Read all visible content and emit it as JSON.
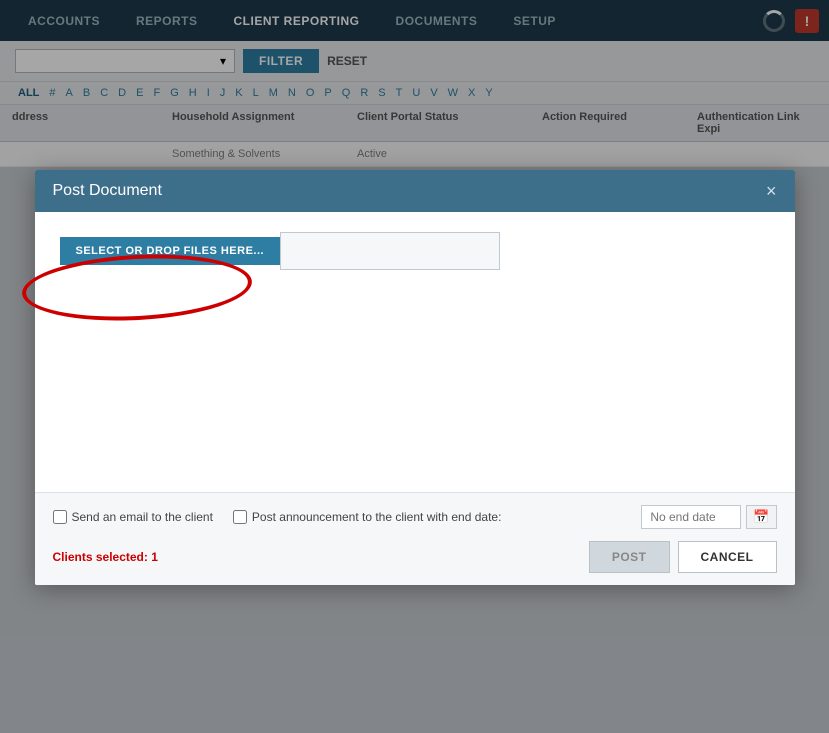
{
  "nav": {
    "items": [
      {
        "id": "accounts",
        "label": "ACCOUNTS",
        "active": false
      },
      {
        "id": "reports",
        "label": "REPORTS",
        "active": false
      },
      {
        "id": "client-reporting",
        "label": "CLIENT REPORTING",
        "active": true
      },
      {
        "id": "documents",
        "label": "DOCUMENTS",
        "active": false
      },
      {
        "id": "setup",
        "label": "SETUP",
        "active": false
      }
    ]
  },
  "filter": {
    "button_label": "FILTER",
    "reset_label": "RESET",
    "dropdown_placeholder": ""
  },
  "alpha_bar": {
    "items": [
      "ALL",
      "#",
      "A",
      "B",
      "C",
      "D",
      "E",
      "F",
      "G",
      "H",
      "I",
      "J",
      "K",
      "L",
      "M",
      "N",
      "O",
      "P",
      "Q",
      "R",
      "S",
      "T",
      "U",
      "V",
      "W",
      "X",
      "Y"
    ]
  },
  "table": {
    "columns": [
      "ddress",
      "Household Assignment",
      "Client Portal Status",
      "Action Required",
      "Authentication Link Expi"
    ],
    "partial_row": [
      "",
      "Something & Solvents",
      "Active",
      "",
      ""
    ]
  },
  "modal": {
    "title": "Post Document",
    "close_label": "×",
    "select_files_btn": "SELECT OR DROP FILES HERE...",
    "drop_placeholder": "",
    "send_email_label": "Send an email to the client",
    "post_announcement_label": "Post announcement to the client with end date:",
    "date_placeholder": "No end date",
    "clients_selected": "Clients selected: 1",
    "post_btn": "POST",
    "cancel_btn": "CANCEL"
  }
}
